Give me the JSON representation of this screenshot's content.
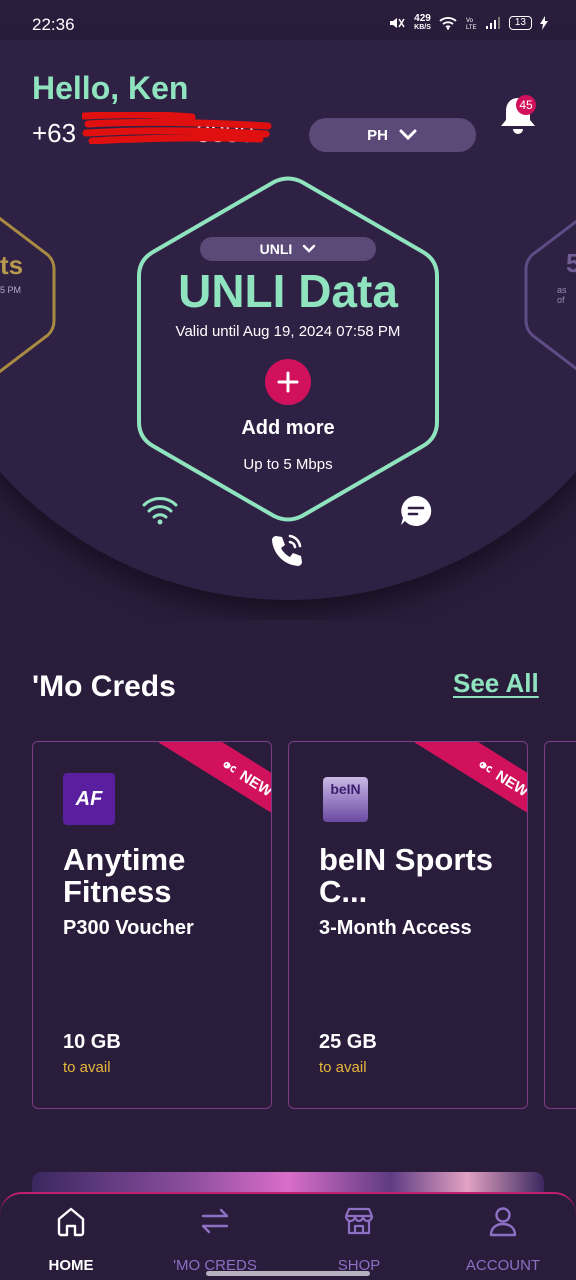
{
  "status_bar": {
    "time": "22:36",
    "net_speed_value": "429",
    "net_speed_unit": "KB/S",
    "battery": "13"
  },
  "header": {
    "greeting": "Hello, Ken",
    "phone_prefix": "+63",
    "phone_suffix": "8380",
    "country": "PH",
    "notification_count": "45"
  },
  "dashboard": {
    "left_card_text": "ts",
    "left_card_sub": "5 PM",
    "right_card_text": "5",
    "right_card_sub": "as of",
    "plan_selector": "UNLI",
    "plan_title": "UNLI Data",
    "validity": "Valid until Aug 19, 2024 07:58 PM",
    "add_more": "Add more",
    "speed": "Up to 5 Mbps"
  },
  "mo_creds": {
    "title": "'Mo Creds",
    "see_all": "See All",
    "cards": [
      {
        "badge": "NEW",
        "name": "Anytime Fitness",
        "description": "P300 Voucher",
        "amount": "10 GB",
        "avail": "to avail",
        "logo_text": "AF"
      },
      {
        "badge": "NEW",
        "name": "beIN Sports C...",
        "description": "3-Month Access",
        "amount": "25 GB",
        "avail": "to avail",
        "logo_text": "beIN"
      }
    ]
  },
  "nav": {
    "items": [
      {
        "label": "HOME",
        "icon": "home-icon"
      },
      {
        "label": "'MO CREDS",
        "icon": "swap-arrows-icon"
      },
      {
        "label": "SHOP",
        "icon": "shop-icon"
      },
      {
        "label": "ACCOUNT",
        "icon": "person-icon"
      }
    ]
  },
  "colors": {
    "background": "#2a1d3c",
    "mint": "#8fe3bf",
    "magenta": "#d1115b",
    "gold": "#e6b73a",
    "purple_pill": "#5b4a78"
  }
}
